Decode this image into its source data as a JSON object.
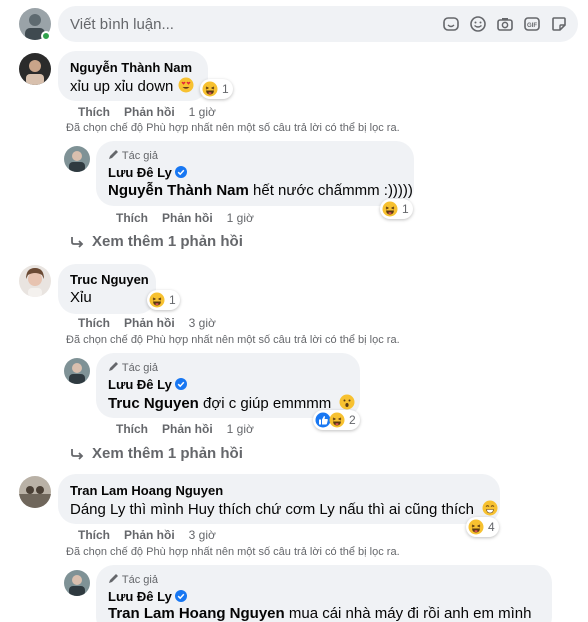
{
  "composer": {
    "placeholder": "Viết bình luận..."
  },
  "labels": {
    "like": "Thích",
    "reply": "Phản hồi",
    "filtered": "Đã chọn chế độ Phù hợp nhất nên một số câu trả lời có thể bị lọc ra.",
    "author_tag": "Tác giả",
    "more_replies": "Xem thêm 1 phản hồi"
  },
  "comments": [
    {
      "name": "Nguyễn Thành Nam",
      "text": "xỉu up xỉu down",
      "time": "1 giờ",
      "reaction_count": "1",
      "reply": {
        "name": "Lưu Đê Ly",
        "mention": "Nguyễn Thành Nam",
        "text": " hết nước chấmmm :)))))",
        "time": "1 giờ",
        "reaction_count": "1"
      }
    },
    {
      "name": "Truc Nguyen",
      "text": "Xỉu",
      "time": "3 giờ",
      "reaction_count": "1",
      "reply": {
        "name": "Lưu Đê Ly",
        "mention": "Truc Nguyen",
        "text": " đợi c giúp emmmm",
        "time": "1 giờ",
        "reaction_count": "2"
      }
    },
    {
      "name": "Tran Lam Hoang Nguyen",
      "text": "Dáng Ly thì mình Huy thích chứ cơm Ly nấu thì ai cũng thích",
      "time": "3 giờ",
      "reaction_count": "4",
      "reply": {
        "name": "Lưu Đê Ly",
        "mention": "Tran Lam Hoang Nguyen",
        "text": " mua cái nhà máy đi rồi anh em mình"
      }
    }
  ],
  "colors": {
    "bubble": "#f0f2f5",
    "secondary_text": "#65676b",
    "verified": "#1877f2",
    "online": "#31a24c"
  }
}
